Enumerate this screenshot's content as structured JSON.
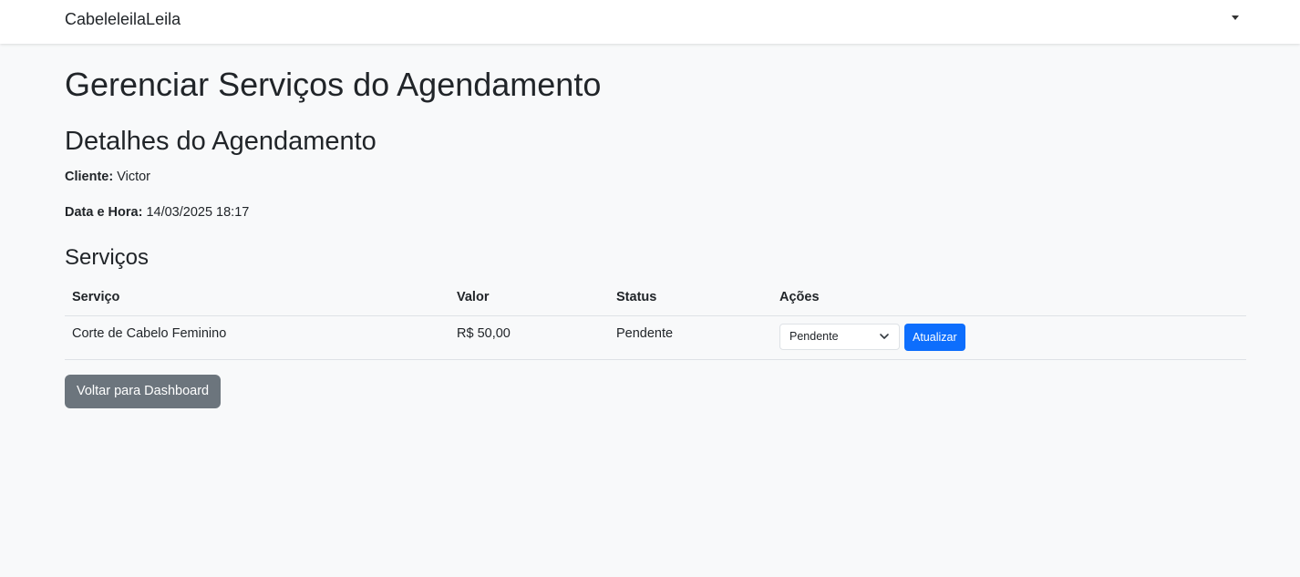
{
  "navbar": {
    "brand": "CabeleleilaLeila",
    "dropdown_icon": "caret-down-icon"
  },
  "page": {
    "title": "Gerenciar Serviços do Agendamento"
  },
  "details": {
    "heading": "Detalhes do Agendamento",
    "client_label": "Cliente:",
    "client_value": "Victor",
    "datetime_label": "Data e Hora:",
    "datetime_value": "14/03/2025 18:17"
  },
  "services": {
    "heading": "Serviços",
    "columns": [
      "Serviço",
      "Valor",
      "Status",
      "Ações"
    ],
    "rows": [
      {
        "service": "Corte de Cabelo Feminino",
        "value": "R$ 50,00",
        "status": "Pendente",
        "select_value": "Pendente",
        "update_label": "Atualizar"
      }
    ]
  },
  "footer": {
    "back_label": "Voltar para Dashboard"
  },
  "colors": {
    "primary": "#0d6efd",
    "secondary": "#6c757d",
    "background": "#f8f9fa"
  }
}
